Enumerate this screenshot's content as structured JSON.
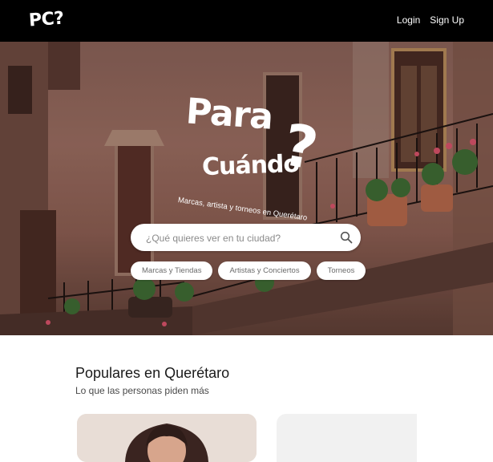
{
  "header": {
    "logo": "PC?",
    "login_label": "Login",
    "signup_label": "Sign Up"
  },
  "hero": {
    "title_line1": "Para",
    "title_line2": "Cuándo",
    "title_mark": "?",
    "subtitle": "Marcas, artista y torneos en Querétaro",
    "search_placeholder": "¿Qué quieres ver en tu ciudad?",
    "chips": [
      "Marcas y Tiendas",
      "Artistas y Conciertos",
      "Torneos"
    ]
  },
  "popular": {
    "title": "Populares en Querétaro",
    "subtitle": "Lo que las personas piden más"
  },
  "colors": {
    "nav_background": "#000000",
    "hero_wall": "#9a6c60",
    "text_dark": "#1a1a1a"
  }
}
